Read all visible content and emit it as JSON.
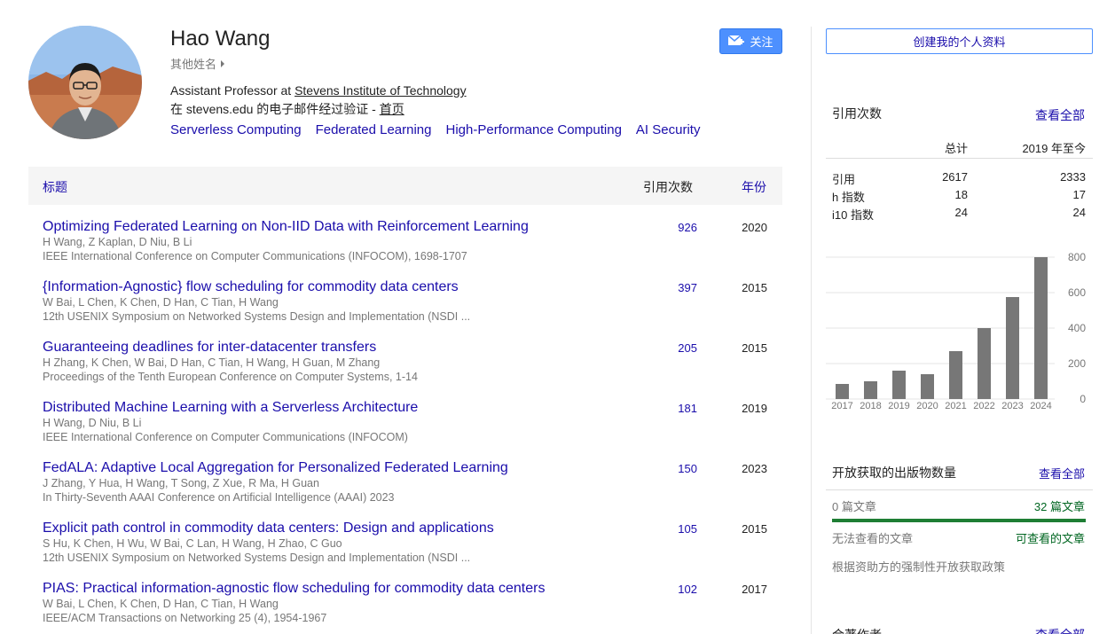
{
  "profile": {
    "name": "Hao Wang",
    "other_names": "其他姓名",
    "affiliation_prefix": "Assistant Professor at ",
    "affiliation_link": "Stevens Institute of Technology",
    "email_text": "在 stevens.edu 的电子邮件经过验证 - ",
    "homepage_link": "首页",
    "interests": [
      "Serverless Computing",
      "Federated Learning",
      "High-Performance Computing",
      "AI Security"
    ],
    "follow_label": "关注"
  },
  "table": {
    "header_title": "标题",
    "header_cites": "引用次数",
    "header_year": "年份",
    "rows": [
      {
        "title": "Optimizing Federated Learning on Non-IID Data with Reinforcement Learning",
        "authors": "H Wang, Z Kaplan, D Niu, B Li",
        "venue": "IEEE International Conference on Computer Communications (INFOCOM), 1698-1707",
        "cites": "926",
        "year": "2020"
      },
      {
        "title": "{Information-Agnostic} flow scheduling for commodity data centers",
        "authors": "W Bai, L Chen, K Chen, D Han, C Tian, H Wang",
        "venue": "12th USENIX Symposium on Networked Systems Design and Implementation (NSDI ...",
        "cites": "397",
        "year": "2015"
      },
      {
        "title": "Guaranteeing deadlines for inter-datacenter transfers",
        "authors": "H Zhang, K Chen, W Bai, D Han, C Tian, H Wang, H Guan, M Zhang",
        "venue": "Proceedings of the Tenth European Conference on Computer Systems, 1-14",
        "cites": "205",
        "year": "2015"
      },
      {
        "title": "Distributed Machine Learning with a Serverless Architecture",
        "authors": "H Wang, D Niu, B Li",
        "venue": "IEEE International Conference on Computer Communications (INFOCOM)",
        "cites": "181",
        "year": "2019"
      },
      {
        "title": "FedALA: Adaptive Local Aggregation for Personalized Federated Learning",
        "authors": "J Zhang, Y Hua, H Wang, T Song, Z Xue, R Ma, H Guan",
        "venue": "In Thirty-Seventh AAAI Conference on Artificial Intelligence (AAAI) 2023",
        "cites": "150",
        "year": "2023"
      },
      {
        "title": "Explicit path control in commodity data centers: Design and applications",
        "authors": "S Hu, K Chen, H Wu, W Bai, C Lan, H Wang, H Zhao, C Guo",
        "venue": "12th USENIX Symposium on Networked Systems Design and Implementation (NSDI ...",
        "cites": "105",
        "year": "2015"
      },
      {
        "title": "PIAS: Practical information-agnostic flow scheduling for commodity data centers",
        "authors": "W Bai, L Chen, K Chen, D Han, C Tian, H Wang",
        "venue": "IEEE/ACM Transactions on Networking 25 (4), 1954-1967",
        "cites": "102",
        "year": "2017"
      }
    ]
  },
  "sidebar": {
    "create_profile_label": "创建我的个人资料",
    "citations_title": "引用次数",
    "view_all": "查看全部",
    "col_total": "总计",
    "col_since": "2019 年至今",
    "metrics": [
      {
        "label": "引用",
        "total": "2617",
        "since": "2333"
      },
      {
        "label": "h 指数",
        "total": "18",
        "since": "17"
      },
      {
        "label": "i10 指数",
        "total": "24",
        "since": "24"
      }
    ],
    "open_access_title": "开放获取的出版物数量",
    "open_access_view_all": "查看全部",
    "oa_unavailable_count": "0 篇文章",
    "oa_available_count": "32 篇文章",
    "oa_unavailable_label": "无法查看的文章",
    "oa_available_label": "可查看的文章",
    "oa_policy": "根据资助方的强制性开放获取政策",
    "coauthors_title": "合著作者",
    "coauthors_view_all": "查看全部"
  },
  "colors": {
    "link": "#1a0dab",
    "bar": "#777777",
    "follow_button": "#4d90fe",
    "oa_green": "#1e7e34"
  },
  "chart_data": {
    "type": "bar",
    "categories": [
      "2017",
      "2018",
      "2019",
      "2020",
      "2021",
      "2022",
      "2023",
      "2024"
    ],
    "values": [
      85,
      100,
      160,
      140,
      270,
      400,
      575,
      800
    ],
    "y_ticks": [
      "800",
      "600",
      "400",
      "200",
      "0"
    ],
    "ylim": [
      0,
      800
    ],
    "grid": true
  }
}
